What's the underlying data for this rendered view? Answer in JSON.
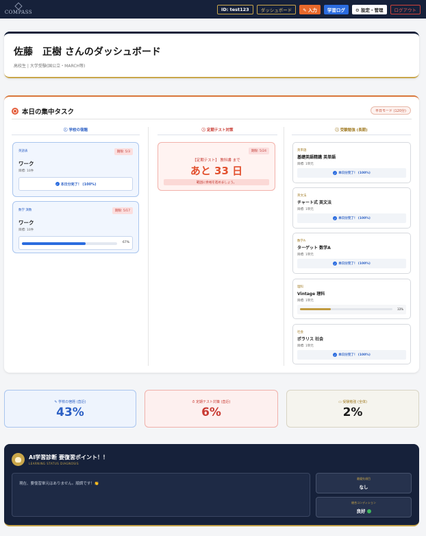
{
  "nav": {
    "logo": "COMPASS",
    "user_id": "ID: test123",
    "dashboard": "ダッシュボード",
    "input": "✎ 入力",
    "study_log": "学習ログ",
    "settings": "⚙ 設定・管理",
    "logout": "ログアウト"
  },
  "header": {
    "title": "佐藤　正樹 さんのダッシュボード",
    "subtitle": "高校生 | 大学受験(国公立・MARCH等)"
  },
  "tasks": {
    "title": "本日の集中タスク",
    "mode_badge": "平日モード (120分)",
    "columns": {
      "school": "ⓘ 学校の宿題",
      "test": "ⓘ 定期テスト対策",
      "exam": "ⓘ 受験勉強 (長期)"
    },
    "school": [
      {
        "subject": "英語表",
        "due": "期限: 5/3",
        "title": "ワーク",
        "amount": "目標: 10件",
        "done": "本日分完了！ (100%)"
      },
      {
        "subject": "数学 演数",
        "due": "期限: 5/17",
        "title": "ワーク",
        "amount": "目標: 10件",
        "progress": 67,
        "progress_label": "67%"
      }
    ],
    "test": {
      "due": "期限: 5/24",
      "label": "【定期テスト】 教科書 まで",
      "countdown": "あと 33 日",
      "message": "範囲に余裕を進めましょう。"
    },
    "exam": [
      {
        "subject": "英単語",
        "title": "基礎英語精講 英単語",
        "amount": "目標: 1単元",
        "done": "本日分完了！ (100%)"
      },
      {
        "subject": "英文法",
        "title": "チャート式 英文法",
        "amount": "目標: 1単元",
        "done": "本日分完了！ (100%)"
      },
      {
        "subject": "数学A",
        "title": "ターゲット 数学A",
        "amount": "目標: 1単元",
        "done": "本日分完了！ (100%)"
      },
      {
        "subject": "理科",
        "title": "Vintage 理科",
        "amount": "目標: 1単元",
        "progress": 33,
        "progress_label": "33%"
      },
      {
        "subject": "社会",
        "title": "ポラリス 社会",
        "amount": "目標: 1単元",
        "done": "本日分完了！ (100%)"
      }
    ]
  },
  "stats": [
    {
      "label": "✎ 学校の宿題 (直近)",
      "value": "43%"
    },
    {
      "label": "⏱ 定期テスト対策 (直近)",
      "value": "6%"
    },
    {
      "label": "▭ 受験勉強 (全体)",
      "value": "2%"
    }
  ],
  "ai": {
    "title": "AI学習診断 要復習ポイント！！",
    "subtitle": "LEARNING STATUS DIAGNOSIS",
    "message": "現在、要復習単元はありません。順調です！👏",
    "box1_key": "最優先項目",
    "box1_value": "なし",
    "box2_key": "総合コンディション",
    "box2_value": "良好"
  },
  "colors": {
    "navy": "#16213a",
    "gold": "#c9a64a",
    "blue": "#2b5fc4",
    "red": "#c83a32",
    "orange": "#e8692c"
  }
}
